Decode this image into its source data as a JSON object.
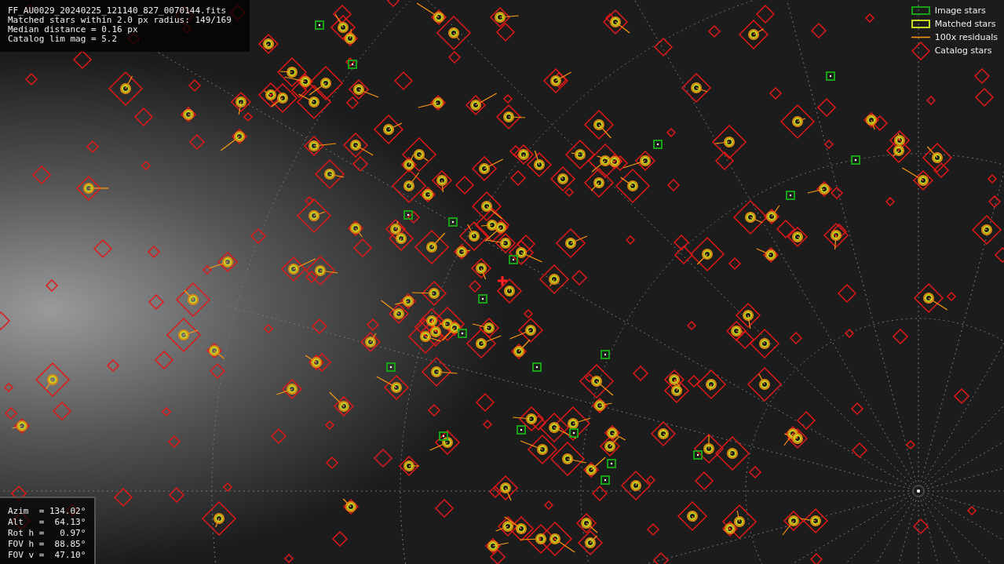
{
  "file_info": {
    "lines": [
      "FF_AU0029_20240225_121140_827_0070144.fits",
      "Matched stars within 2.0 px radius: 149/169",
      "Median distance = 0.16 px",
      "Catalog lim mag = 5.2"
    ]
  },
  "legend": [
    {
      "kind": "image",
      "label": "Image stars"
    },
    {
      "kind": "matched",
      "label": "Matched stars"
    },
    {
      "kind": "residual",
      "label": "100x residuals"
    },
    {
      "kind": "catalog",
      "label": "Catalog stars"
    }
  ],
  "pointing": {
    "lines": [
      "Azim  = 134.02°",
      "Alt   =  64.13°",
      "Rot h =   0.97°",
      "FOV h =  88.85°",
      "FOV v =  47.10°"
    ]
  }
}
